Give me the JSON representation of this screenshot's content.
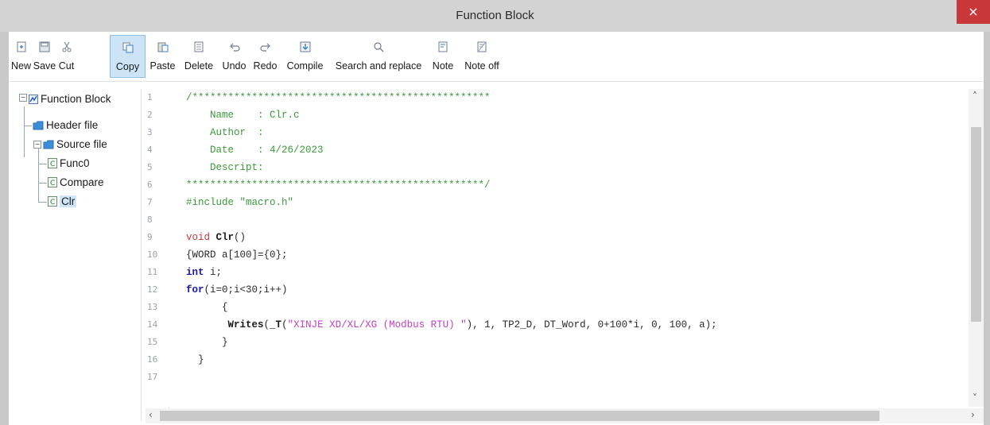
{
  "window": {
    "title": "Function Block",
    "close_glyph": "×"
  },
  "toolbar": {
    "buttons": [
      {
        "label": "New",
        "icon": "new-file-icon"
      },
      {
        "label": "Save",
        "icon": "save-icon"
      },
      {
        "label": "Cut",
        "icon": "scissors-icon"
      },
      {
        "label": "Copy",
        "icon": "copy-icon",
        "active": true
      },
      {
        "label": "Paste",
        "icon": "paste-icon"
      },
      {
        "label": "Delete",
        "icon": "delete-icon"
      },
      {
        "label": "Undo",
        "icon": "undo-icon"
      },
      {
        "label": "Redo",
        "icon": "redo-icon"
      },
      {
        "label": "Compile",
        "icon": "compile-icon"
      },
      {
        "label": "Search and replace",
        "icon": "search-replace-icon"
      },
      {
        "label": "Note",
        "icon": "note-icon"
      },
      {
        "label": "Note off",
        "icon": "note-off-icon"
      }
    ]
  },
  "tree": {
    "root": "Function Block",
    "header": "Header file",
    "source": "Source file",
    "files": [
      "Func0",
      "Compare",
      "Clr"
    ],
    "selected": "Clr"
  },
  "editor": {
    "line_numbers": [
      "1",
      "2",
      "3",
      "4",
      "5",
      "6",
      "7",
      "8",
      "9",
      "10",
      "11",
      "12",
      "13",
      "14",
      "15",
      "16",
      "17"
    ],
    "lines": [
      {
        "indent": "",
        "parts": [
          {
            "c": "cm",
            "t": "/**************************************************"
          }
        ]
      },
      {
        "indent": "    ",
        "parts": [
          {
            "c": "cm",
            "t": "Name    : Clr.c"
          }
        ]
      },
      {
        "indent": "    ",
        "parts": [
          {
            "c": "cm",
            "t": "Author  :"
          }
        ]
      },
      {
        "indent": "    ",
        "parts": [
          {
            "c": "cm",
            "t": "Date    : 4/26/2023"
          }
        ]
      },
      {
        "indent": "    ",
        "parts": [
          {
            "c": "cm",
            "t": "Descript:"
          }
        ]
      },
      {
        "indent": "",
        "parts": [
          {
            "c": "cm",
            "t": "**************************************************/"
          }
        ]
      },
      {
        "indent": "",
        "parts": [
          {
            "c": "cm",
            "t": "#include \"macro.h\""
          }
        ]
      },
      {
        "indent": "",
        "parts": []
      },
      {
        "indent": "",
        "parts": [
          {
            "c": "kr",
            "t": "void "
          },
          {
            "c": "fn",
            "t": "Clr"
          },
          {
            "c": "",
            "t": "()"
          }
        ]
      },
      {
        "indent": "",
        "parts": [
          {
            "c": "",
            "t": "{WORD a[100]={0};"
          }
        ]
      },
      {
        "indent": "",
        "parts": [
          {
            "c": "kw",
            "t": "int"
          },
          {
            "c": "",
            "t": " i;"
          }
        ]
      },
      {
        "indent": "",
        "parts": [
          {
            "c": "kw",
            "t": "for"
          },
          {
            "c": "",
            "t": "(i=0;i<30;i++)"
          }
        ]
      },
      {
        "indent": "      ",
        "parts": [
          {
            "c": "",
            "t": "{"
          }
        ]
      },
      {
        "indent": "       ",
        "parts": [
          {
            "c": "fn",
            "t": "Writes"
          },
          {
            "c": "",
            "t": "("
          },
          {
            "c": "fn",
            "t": "_T"
          },
          {
            "c": "",
            "t": "("
          },
          {
            "c": "st",
            "t": "\"XINJE XD/XL/XG (Modbus RTU) \""
          },
          {
            "c": "",
            "t": "), 1, TP2_D, DT_Word, 0+100*i, 0, 100, a);"
          }
        ]
      },
      {
        "indent": "      ",
        "parts": [
          {
            "c": "",
            "t": "}"
          }
        ]
      },
      {
        "indent": "  ",
        "parts": [
          {
            "c": "",
            "t": "}"
          }
        ]
      },
      {
        "indent": "",
        "parts": []
      }
    ]
  },
  "scroll": {
    "left": "‹",
    "right": "›",
    "up": "˄",
    "down": "˅"
  },
  "colors": {
    "title_bg": "#d3d3d3",
    "close_bg": "#c8383a",
    "active_bg": "#cde4f7",
    "comment": "#3a9b3a",
    "keyword": "#1a1aa6",
    "string": "#c63ec6"
  }
}
